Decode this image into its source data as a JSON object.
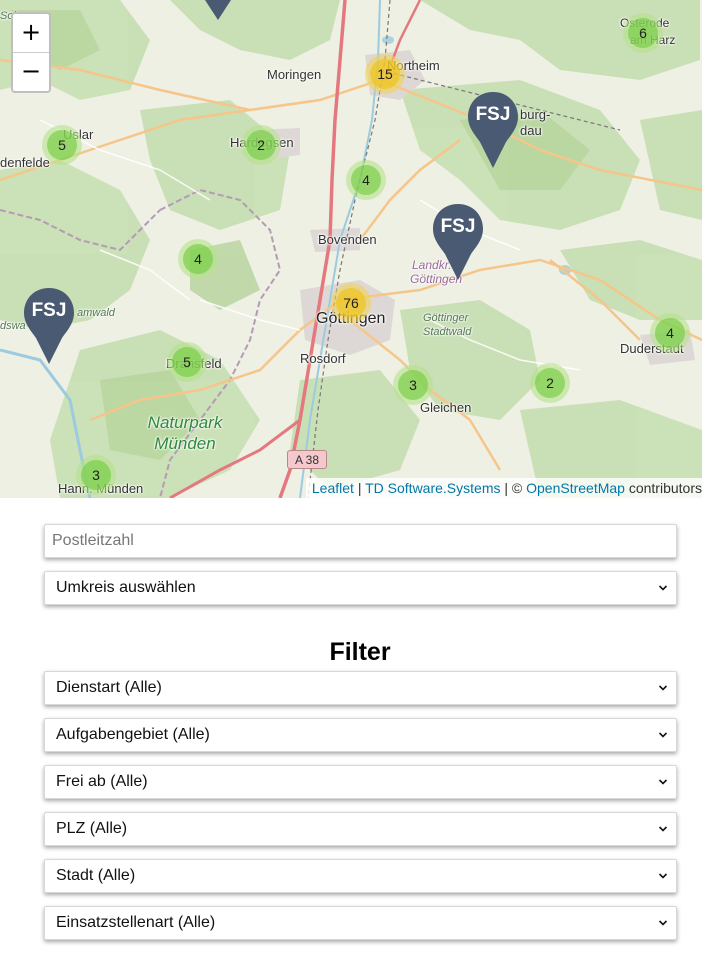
{
  "map": {
    "zoom_in_label": "+",
    "zoom_out_label": "−",
    "places": {
      "moringen": "Moringen",
      "northeim": "Northeim",
      "uslar": "Uslar",
      "hardegsen": "Hardegsen",
      "bovenden": "Bovenden",
      "goettingen": "Göttingen",
      "rosdorf": "Rosdorf",
      "dransfeld": "Dransfeld",
      "gleichen": "Gleichen",
      "duderstadt": "Duderstadt",
      "hann_muenden": "Hann. Münden",
      "bodenfelde": "denfelde",
      "katlenburg": "burg-",
      "lindau": "dau",
      "osterode": "Osterode",
      "osterode2": "am Harz",
      "landkreis1": "Landkr.",
      "landkreis2": "Göttingen",
      "stadtwald1": "Göttinger",
      "stadtwald2": "Stadtwald",
      "bramwald": "amwald",
      "sollingwald": "dswa",
      "solling_top": "Sol",
      "park1": "Naturpark",
      "park2": "Münden"
    },
    "road_shield": "A 38",
    "clusters": [
      {
        "count": "15",
        "size": "medium"
      },
      {
        "count": "6",
        "size": "small"
      },
      {
        "count": "5",
        "size": "small"
      },
      {
        "count": "2",
        "size": "small"
      },
      {
        "count": "4",
        "size": "small"
      },
      {
        "count": "4",
        "size": "small"
      },
      {
        "count": "76",
        "size": "medium"
      },
      {
        "count": "5",
        "size": "small"
      },
      {
        "count": "3",
        "size": "small"
      },
      {
        "count": "2",
        "size": "small"
      },
      {
        "count": "4",
        "size": "small"
      },
      {
        "count": "3",
        "size": "small"
      }
    ],
    "markers": [
      {
        "label": "FSJ"
      },
      {
        "label": "FSJ"
      },
      {
        "label": "FSJ"
      }
    ],
    "attribution": {
      "leaflet": "Leaflet",
      "sep1": " | ",
      "td": "TD Software.Systems",
      "sep2": " | © ",
      "osm": "OpenStreetMap",
      "contributors": " contributors"
    },
    "colors": {
      "marker": "#4a5a72",
      "cluster_small": "#6ecc39",
      "cluster_medium": "#f0c20c"
    }
  },
  "search": {
    "plz_placeholder": "Postleitzahl",
    "radius_label": "Umkreis auswählen"
  },
  "filter": {
    "title": "Filter",
    "selects": [
      "Dienstart (Alle)",
      "Aufgabengebiet (Alle)",
      "Frei ab (Alle)",
      "PLZ (Alle)",
      "Stadt (Alle)",
      "Einsatzstellenart (Alle)"
    ]
  }
}
